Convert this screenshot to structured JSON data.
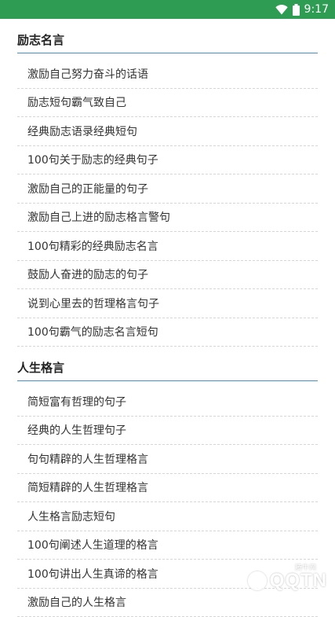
{
  "status_bar": {
    "time": "9:17",
    "icons": [
      "wifi-icon",
      "battery-icon"
    ],
    "background": "#2e9c52"
  },
  "sections": [
    {
      "title": "励志名言",
      "items": [
        "激励自己努力奋斗的话语",
        "励志短句霸气致自己",
        "经典励志语录经典短句",
        "100句关于励志的经典句子",
        "激励自己的正能量的句子",
        "激励自己上进的励志格言警句",
        "100句精彩的经典励志名言",
        "鼓励人奋进的励志的句子",
        "说到心里去的哲理格言句子",
        "100句霸气的励志名言短句"
      ]
    },
    {
      "title": "人生格言",
      "items": [
        "简短富有哲理的句子",
        "经典的人生哲理句子",
        "句句精辟的人生哲理格言",
        "简短精辟的人生哲理格言",
        "人生格言励志短句",
        "100句阐述人生道理的格言",
        "100句讲出人生真谛的格言",
        "激励自己的人生格言"
      ]
    }
  ],
  "watermark": {
    "text": "QQTN",
    "small_text": "腾牛网"
  },
  "colors": {
    "accent_line": "#4a8fcf",
    "divider": "#d6d6d6"
  }
}
